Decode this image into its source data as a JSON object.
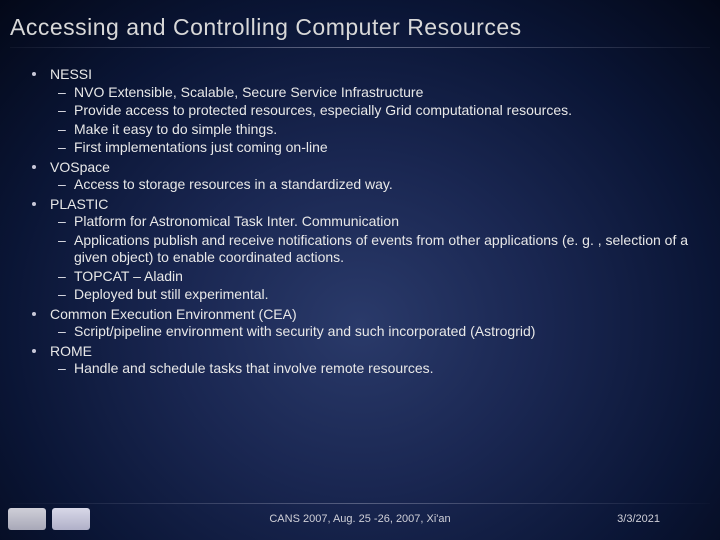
{
  "title": "Accessing  and Controlling Computer Resources",
  "items": [
    {
      "label": "NESSI",
      "sub": [
        "NVO Extensible, Scalable, Secure Service Infrastructure",
        "Provide access to protected resources, especially Grid computational resources.",
        "Make it easy to do simple things.",
        "First implementations just coming on-line"
      ]
    },
    {
      "label": "VOSpace",
      "sub": [
        "Access to storage resources in a standardized way."
      ]
    },
    {
      "label": "PLASTIC",
      "sub": [
        "Platform for Astronomical Task Inter. Communication",
        "Applications publish and receive notifications of events from other applications (e. g. , selection of a given object) to enable coordinated actions.",
        "TOPCAT – Aladin",
        "Deployed but still experimental."
      ]
    },
    {
      "label": "Common Execution Environment (CEA)",
      "sub": [
        "Script/pipeline environment with security and such incorporated (Astrogrid)"
      ]
    },
    {
      "label": "ROME",
      "sub": [
        "Handle and schedule tasks that involve remote resources."
      ]
    }
  ],
  "footer": {
    "venue": "CANS 2007, Aug. 25 -26, 2007, Xi'an",
    "date": "3/3/2021"
  }
}
